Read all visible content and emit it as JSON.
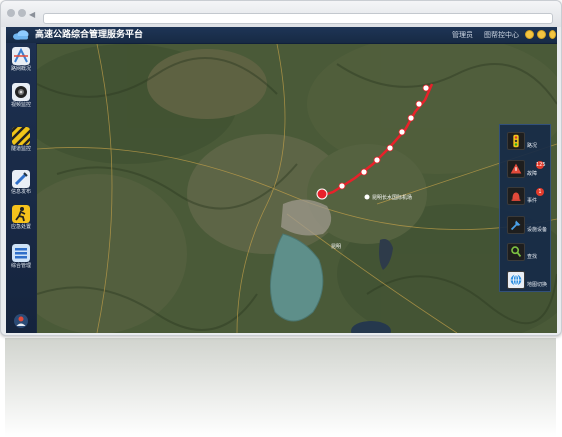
{
  "header": {
    "title": "高速公路综合管理服务平台",
    "links": [
      "管理员",
      "图帮控中心"
    ]
  },
  "sidebar": {
    "items": [
      {
        "label": "路网概况",
        "icon": "road-network-icon"
      },
      {
        "label": "视频监控",
        "icon": "camera-icon"
      },
      {
        "label": "隧道监控",
        "icon": "tunnel-icon"
      },
      {
        "label": "信息发布",
        "icon": "info-publish-icon"
      },
      {
        "label": "应急处置",
        "icon": "emergency-icon"
      },
      {
        "label": "综合管理",
        "icon": "management-icon"
      }
    ]
  },
  "map": {
    "place_label": "昆明长水国际机场",
    "city_label": "昆明"
  },
  "panel": {
    "items": [
      {
        "label": "路况",
        "icon": "traffic-light-icon"
      },
      {
        "label": "故障",
        "icon": "fault-warning-icon",
        "badge": "125"
      },
      {
        "label": "事件",
        "icon": "event-bell-icon",
        "badge": "1"
      },
      {
        "label": "设施设备",
        "icon": "facility-pin-icon"
      },
      {
        "label": "查找",
        "icon": "search-icon"
      },
      {
        "label": "地图切换",
        "icon": "map-switch-icon"
      }
    ]
  },
  "colors": {
    "header_bg": "#1e3556",
    "route_red": "#e8212a",
    "badge_red": "#e23b2b",
    "window_button": "#f4c542"
  }
}
